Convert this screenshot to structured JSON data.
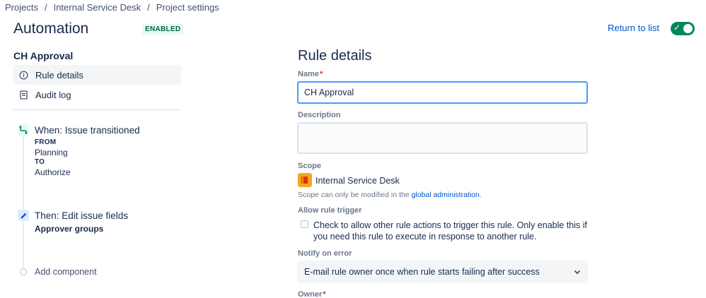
{
  "breadcrumb": [
    "Projects",
    "Internal Service Desk",
    "Project settings"
  ],
  "breadcrumb_separator": "/",
  "page": {
    "title": "Automation",
    "status": "ENABLED"
  },
  "header": {
    "return_label": "Return to list",
    "toggle_on": true
  },
  "sidebar": {
    "rule_name": "CH Approval",
    "nav": [
      {
        "label": "Rule details",
        "icon": "info-icon",
        "active": true
      },
      {
        "label": "Audit log",
        "icon": "document-icon",
        "active": false
      }
    ],
    "trigger": {
      "title": "When: Issue transitioned",
      "from_label": "FROM",
      "from_value": "Planning",
      "to_label": "TO",
      "to_value": "Authorize"
    },
    "action": {
      "title": "Then: Edit issue fields",
      "detail": "Approver groups"
    },
    "add_component": "Add component"
  },
  "form": {
    "title": "Rule details",
    "name_label": "Name",
    "name_value": "CH Approval",
    "description_label": "Description",
    "description_value": "",
    "scope_label": "Scope",
    "scope_value": "Internal Service Desk",
    "scope_note": "Scope can only be modified in the",
    "scope_link": "global administration",
    "scope_note_end": ".",
    "trigger_label": "Allow rule trigger",
    "trigger_text": "Check to allow other rule actions to trigger this rule. Only enable this if you need this rule to execute in response to another rule.",
    "trigger_checked": false,
    "notify_label": "Notify on error",
    "notify_value": "E-mail rule owner once when rule starts failing after success",
    "owner_label": "Owner"
  },
  "colors": {
    "accent": "#0052cc",
    "enabled": "#00875a",
    "focus": "#4c9aff"
  }
}
